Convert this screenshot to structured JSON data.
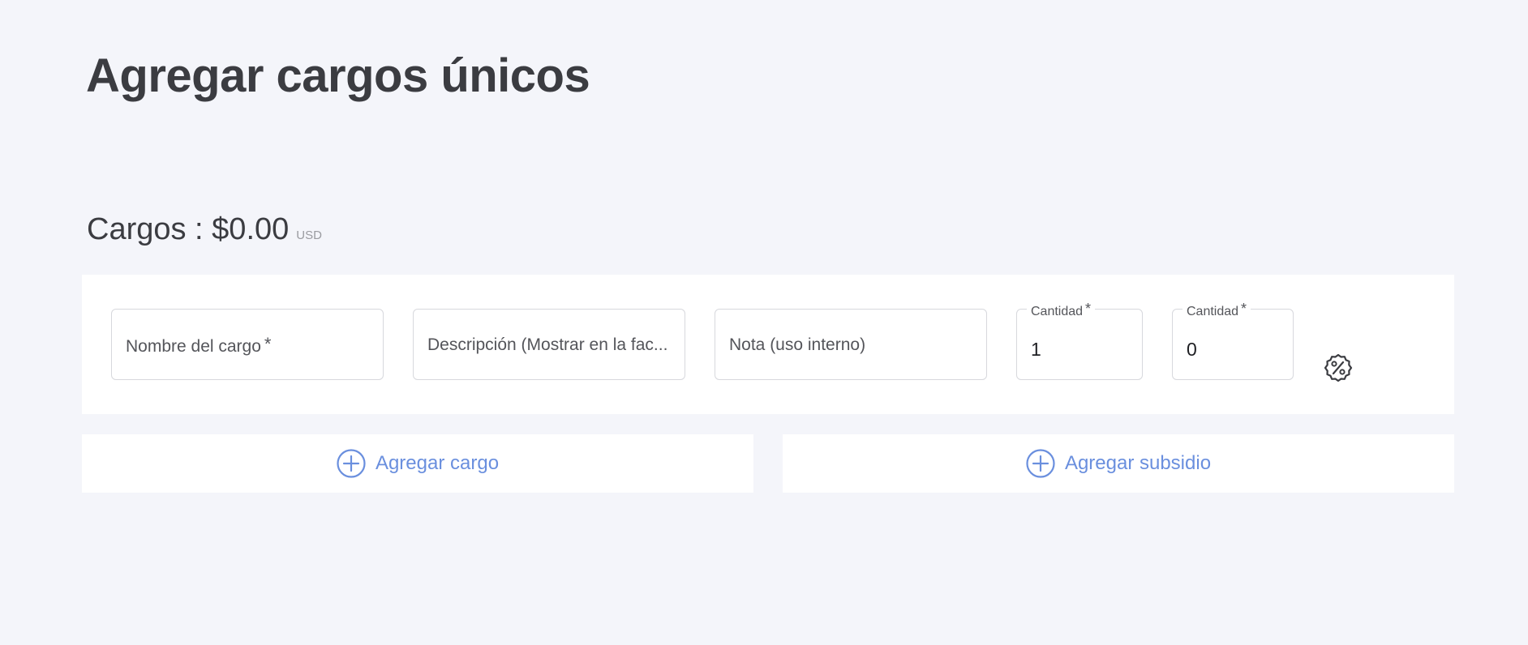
{
  "page": {
    "title": "Agregar cargos únicos"
  },
  "summary": {
    "label": "Cargos : $0.00",
    "currency": "USD"
  },
  "charge_row": {
    "name_placeholder": "Nombre del cargo",
    "description_placeholder": "Descripción (Mostrar en la fac...",
    "note_placeholder": "Nota (uso interno)",
    "quantity_label": "Cantidad",
    "quantity_value": "1",
    "amount_label": "Cantidad",
    "amount_value": "0",
    "required_mark": "*",
    "discount_icon": "percent-badge-icon"
  },
  "actions": {
    "add_charge_label": "Agregar cargo",
    "add_subsidy_label": "Agregar subsidio",
    "icon": "plus-circle-icon"
  },
  "colors": {
    "background": "#f4f5fa",
    "accent": "#6a8fde",
    "text": "#3b3c41"
  }
}
